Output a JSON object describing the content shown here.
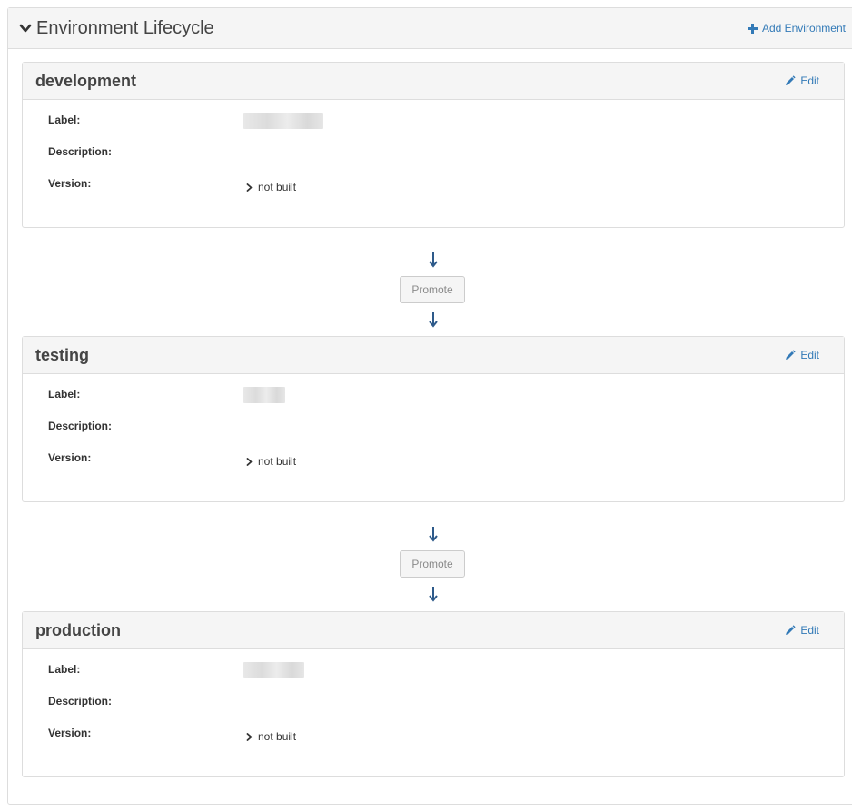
{
  "section": {
    "title": "Environment Lifecycle",
    "add_label": "Add Environment"
  },
  "environments": [
    {
      "name": "development",
      "edit_label": "Edit",
      "version_value": "not built"
    },
    {
      "name": "testing",
      "edit_label": "Edit",
      "version_value": "not built"
    },
    {
      "name": "production",
      "edit_label": "Edit",
      "version_value": "not built"
    }
  ],
  "labels": {
    "label": "Label:",
    "description": "Description:",
    "version": "Version:"
  },
  "promote_label": "Promote",
  "colors": {
    "link": "#337ab7",
    "heading_bg": "#f5f5f5",
    "border": "#dddddd",
    "arrow": "#2e5a8a"
  },
  "icons": {
    "collapse": "chevron-down-icon",
    "add": "plus-icon",
    "edit": "pencil-icon",
    "version": "chevron-right-icon",
    "flow": "arrow-down-icon"
  }
}
